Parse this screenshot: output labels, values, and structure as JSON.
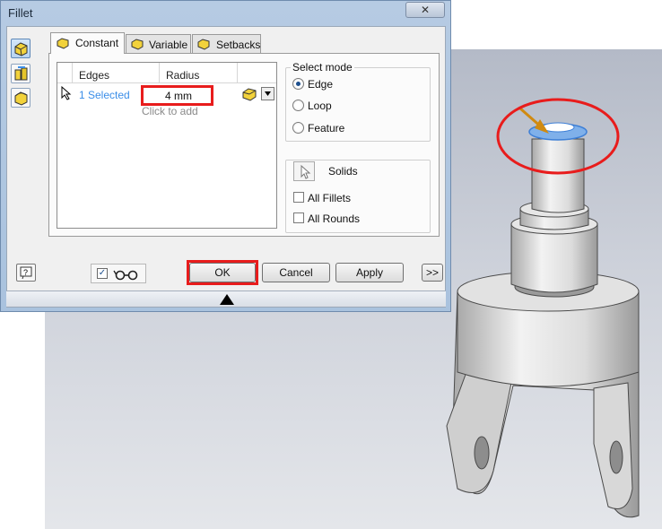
{
  "dialog": {
    "title": "Fillet",
    "close_label": "✕"
  },
  "tabs": [
    {
      "label": "Constant",
      "active": true
    },
    {
      "label": "Variable",
      "active": false
    },
    {
      "label": "Setbacks",
      "active": false
    }
  ],
  "edges_table": {
    "headers": [
      "Edges",
      "Radius"
    ],
    "rows": [
      {
        "edges": "1 Selected",
        "radius": "4 mm"
      }
    ],
    "add_hint": "Click to add"
  },
  "select_mode": {
    "title": "Select mode",
    "options": [
      "Edge",
      "Loop",
      "Feature"
    ],
    "selected": "Edge"
  },
  "solids": {
    "label": "Solids",
    "checkboxes": [
      {
        "label": "All Fillets",
        "checked": false
      },
      {
        "label": "All Rounds",
        "checked": false
      }
    ]
  },
  "buttons": {
    "ok": "OK",
    "cancel": "Cancel",
    "apply": "Apply",
    "expand": ">>"
  },
  "preview_checked": true,
  "colors": {
    "highlight_outline": "#e81c1c",
    "link_blue": "#3b8ee8",
    "selection_blue": "#4d90e6"
  }
}
